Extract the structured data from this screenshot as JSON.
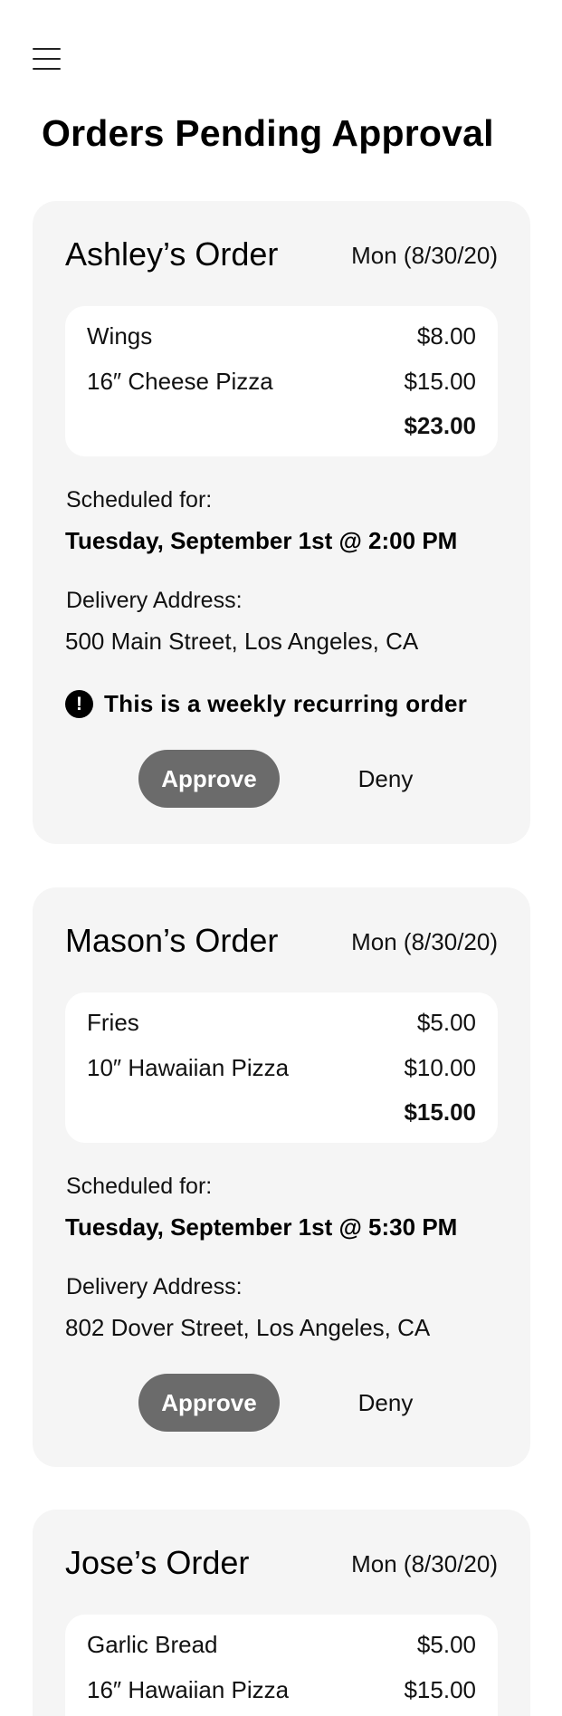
{
  "header": {
    "menu_icon": "hamburger-menu-icon",
    "title": "Orders Pending Approval"
  },
  "orders": [
    {
      "name": "Ashley’s Order",
      "date": "Mon (8/30/20)",
      "items": [
        {
          "name": "Wings",
          "price": "$8.00"
        },
        {
          "name": "16″ Cheese Pizza",
          "price": "$15.00"
        }
      ],
      "total": "$23.00",
      "scheduled_label": "Scheduled for:",
      "scheduled_value": "Tuesday, September 1st @ 2:00 PM",
      "address_label": "Delivery Address:",
      "address_value": "500 Main Street, Los Angeles, CA",
      "notice_icon": "exclamation-circle-icon",
      "notice_icon_glyph": "!",
      "notice_text": "This is a weekly recurring order",
      "approve_label": "Approve",
      "deny_label": "Deny"
    },
    {
      "name": "Mason’s Order",
      "date": "Mon (8/30/20)",
      "items": [
        {
          "name": "Fries",
          "price": "$5.00"
        },
        {
          "name": "10″ Hawaiian Pizza",
          "price": "$10.00"
        }
      ],
      "total": "$15.00",
      "scheduled_label": "Scheduled for:",
      "scheduled_value": "Tuesday, September 1st @ 5:30 PM",
      "address_label": "Delivery Address:",
      "address_value": "802 Dover Street, Los Angeles, CA",
      "approve_label": "Approve",
      "deny_label": "Deny"
    },
    {
      "name": "Jose’s Order",
      "date": "Mon (8/30/20)",
      "items": [
        {
          "name": "Garlic Bread",
          "price": "$5.00"
        },
        {
          "name": "16″ Hawaiian Pizza",
          "price": "$15.00"
        }
      ]
    }
  ],
  "colors": {
    "card_background": "#f5f5f5",
    "approve_button": "#6b6b6b"
  }
}
